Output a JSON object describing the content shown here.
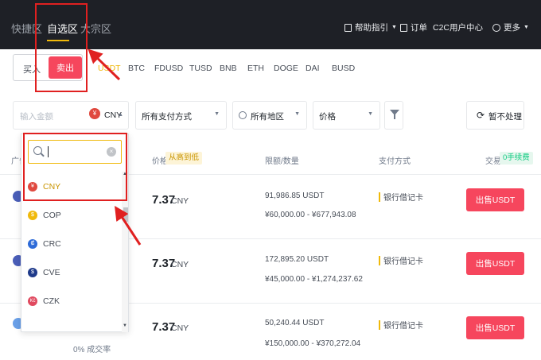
{
  "topnav": {
    "tabs": [
      {
        "label": "快捷区"
      },
      {
        "label": "自选区"
      },
      {
        "label": "大宗区"
      }
    ],
    "help_label": "帮助指引",
    "orders_label": "订单",
    "user_center_label": "C2C用户中心",
    "more_label": "更多"
  },
  "trade": {
    "buy_label": "买入",
    "sell_label": "卖出"
  },
  "coins": [
    "USDT",
    "BTC",
    "FDUSD",
    "TUSD",
    "BNB",
    "ETH",
    "DOGE",
    "DAI",
    "BUSD"
  ],
  "filters": {
    "amount_placeholder": "输入金额",
    "currency": "CNY",
    "payment": "所有支付方式",
    "region": "所有地区",
    "price": "价格",
    "no_process": "暂不处理"
  },
  "table": {
    "headers": {
      "advertiser": "广告",
      "price": "价格",
      "price_sort": "从高到低",
      "limit": "限额/数量",
      "payment": "支付方式",
      "trade": "交易",
      "fee_badge": "0手续费"
    },
    "rows": [
      {
        "price": "7.37",
        "unit": "CNY",
        "available": "91,986.85 USDT",
        "limit": "¥60,000.00 - ¥677,943.08",
        "payment": "银行借记卡",
        "action": "出售USDT"
      },
      {
        "price": "7.37",
        "unit": "CNY",
        "available": "172,895.20 USDT",
        "limit": "¥45,000.00 - ¥1,274,237.62",
        "payment": "银行借记卡",
        "action": "出售USDT"
      },
      {
        "price": "7.37",
        "unit": "CNY",
        "available": "50,240.44 USDT",
        "limit": "¥150,000.00 - ¥370,272.04",
        "payment": "银行借记卡",
        "action": "出售USDT"
      }
    ],
    "partial_text": "0% 成交率"
  },
  "currency_dropdown": {
    "options": [
      {
        "code": "CNY",
        "symbol": "¥",
        "color": "#e0493f"
      },
      {
        "code": "COP",
        "symbol": "$",
        "color": "#f0b90b"
      },
      {
        "code": "CRC",
        "symbol": "₡",
        "color": "#2e6bd8"
      },
      {
        "code": "CVE",
        "symbol": "$",
        "color": "#1e3a8a"
      },
      {
        "code": "CZK",
        "symbol": "Kč",
        "color": "#e0495f"
      }
    ]
  },
  "colors": {
    "accent": "#f0b90b",
    "sell": "#f6465d",
    "nav_bg": "#1e2026",
    "annotation": "#e02020"
  }
}
